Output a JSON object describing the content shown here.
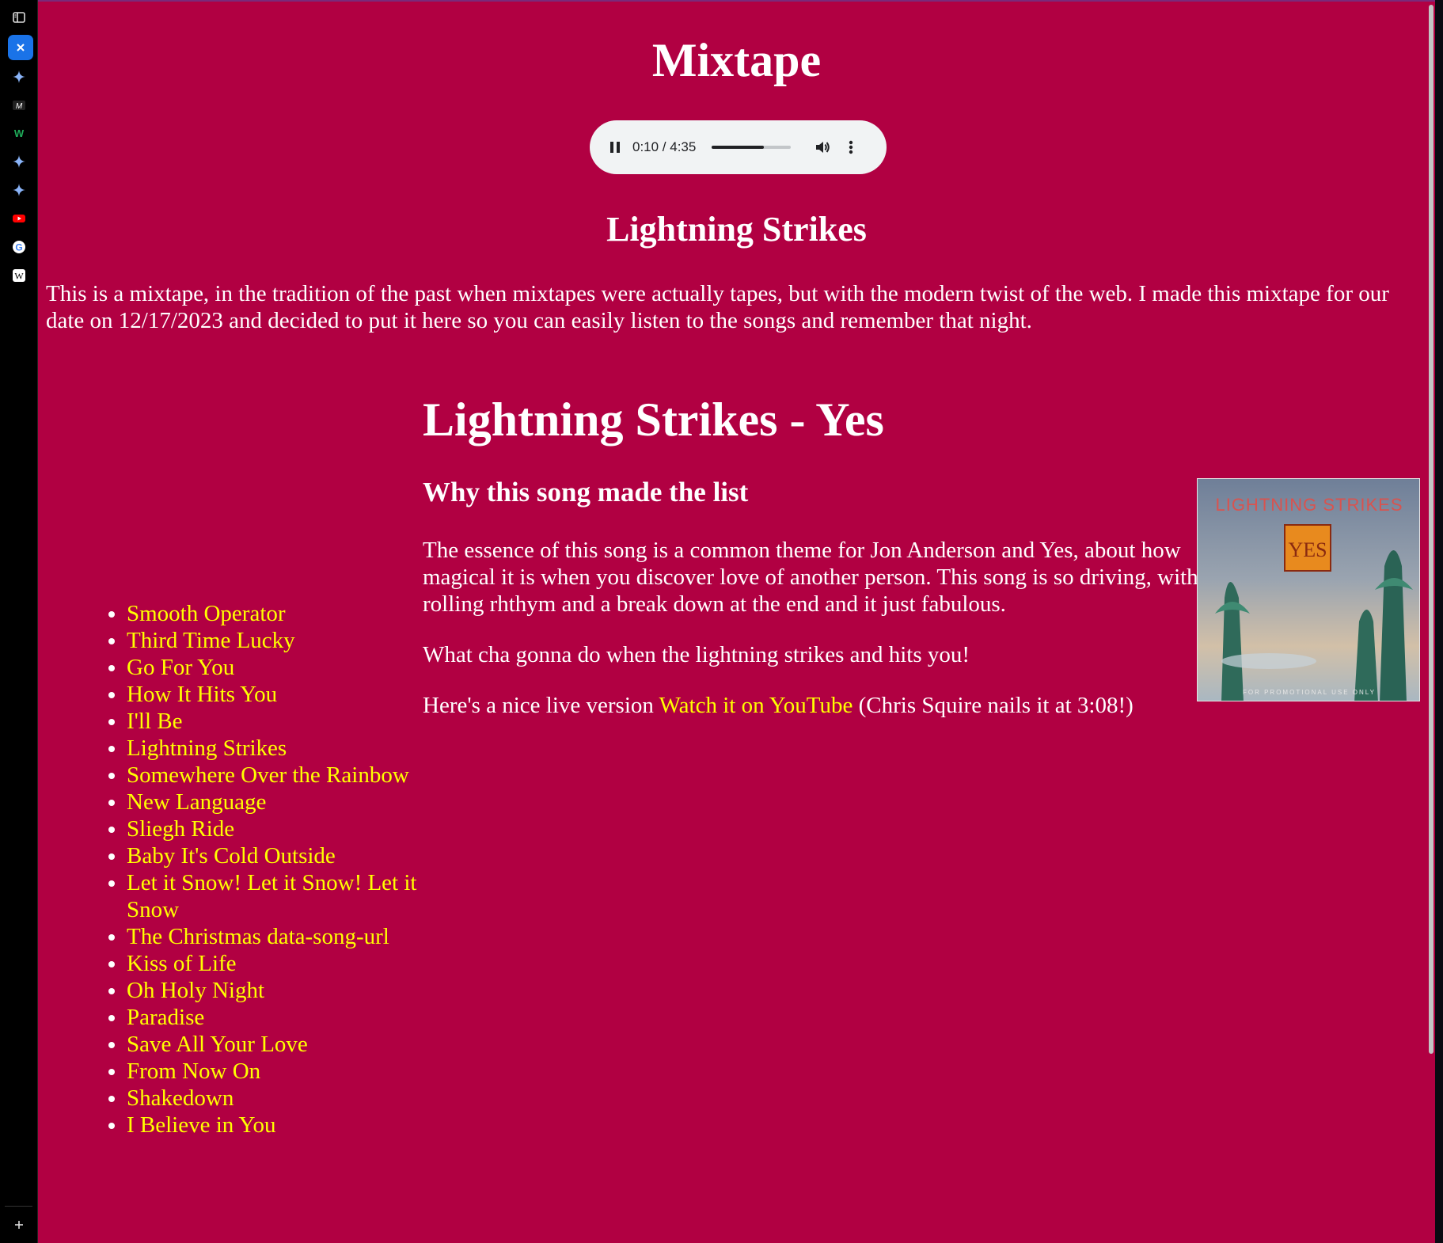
{
  "page": {
    "title": "Mixtape",
    "now_playing": "Lightning Strikes",
    "intro": "This is a mixtape, in the tradition of the past when mixtapes were actually tapes, but with the modern twist of the web. I made this mixtape for our date on 12/17/2023 and decided to put it here so you can easily listen to the songs and remember that night."
  },
  "audio_player": {
    "time": "0:10 / 4:35",
    "progress_fraction": 0.66
  },
  "songs": [
    "Smooth Operator",
    "Third Time Lucky",
    "Go For You",
    "How It Hits You",
    "I'll Be",
    "Lightning Strikes",
    "Somewhere Over the Rainbow",
    "New Language",
    "Sliegh Ride",
    "Baby It's Cold Outside",
    "Let it Snow! Let it Snow! Let it Snow",
    "The Christmas data-song-url",
    "Kiss of Life",
    "Oh Holy Night",
    "Paradise",
    "Save All Your Love",
    "From Now On",
    "Shakedown",
    "I Believe in You"
  ],
  "song_detail": {
    "heading": "Lightning Strikes - Yes",
    "why_heading": "Why this song made the list",
    "essence": "The essence of this song is a common theme for Jon Anderson and Yes, about how magical it is when you discover love of another person. This song is so driving, with a rolling rhthym and a break down at the end and it just fabulous.",
    "lightning_line": "What cha gonna do when the lightning strikes and hits you!",
    "live_prefix": "Here's a nice live version ",
    "live_link": "Watch it on YouTube",
    "live_suffix": " (Chris Squire nails it at 3:08!)"
  },
  "album_art": {
    "title_text": "LIGHTNING STRIKES",
    "logo_text": "YES",
    "footer_text": "FOR PROMOTIONAL USE ONLY"
  },
  "sidebar_icons": [
    "sidebar-toggle-icon",
    "close-tab-icon",
    "gemini-icon",
    "medium-icon",
    "webflow-icon",
    "gemini-icon",
    "gemini-icon",
    "youtube-icon",
    "google-icon",
    "wikipedia-icon",
    "plus-icon"
  ],
  "colors": {
    "page_background": "#b10042",
    "link": "#ffff00",
    "text": "#ffffff"
  }
}
